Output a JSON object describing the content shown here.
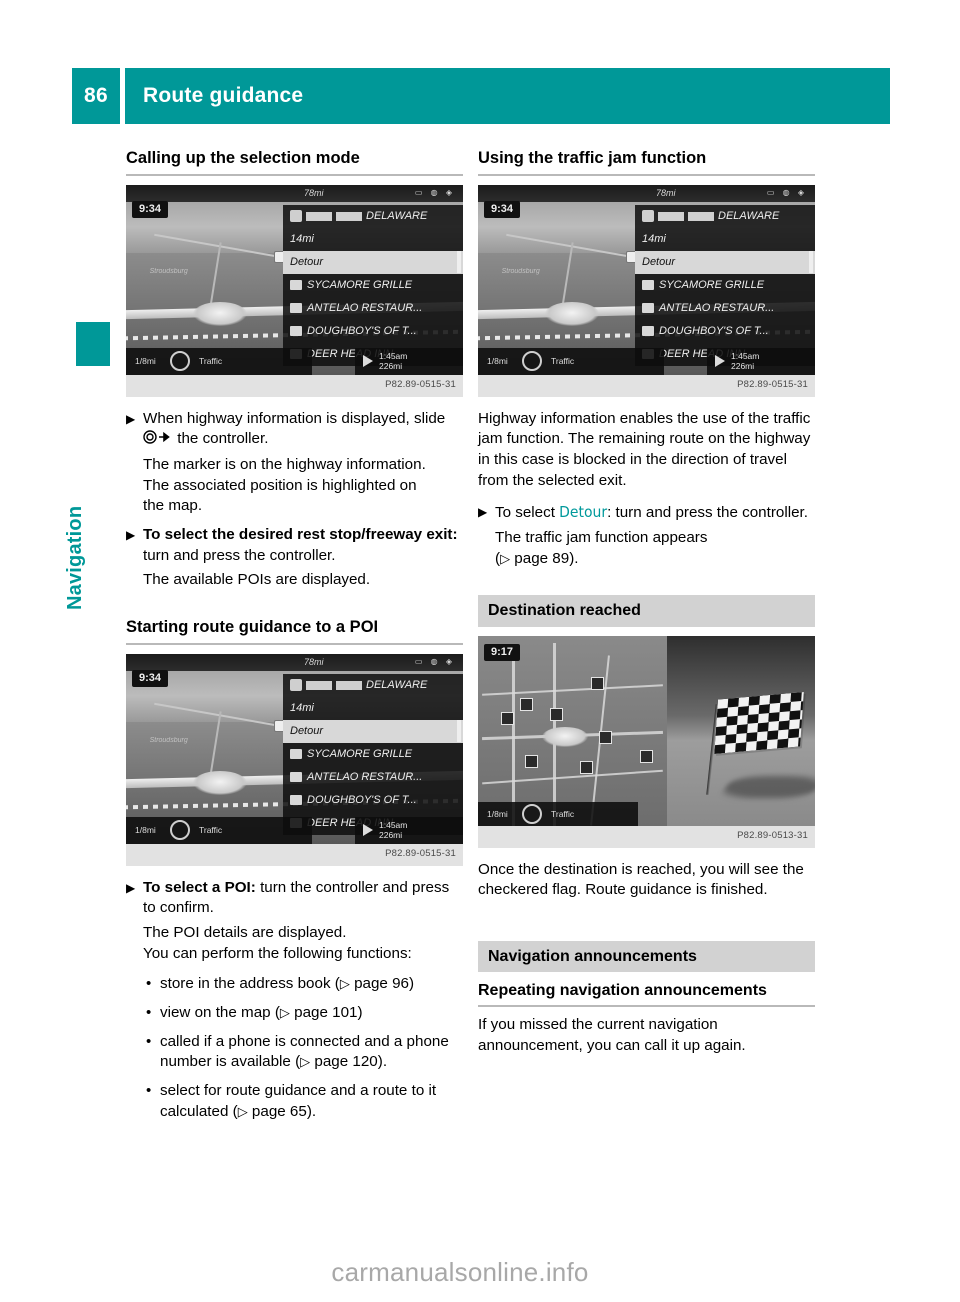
{
  "header": {
    "page_number": "86",
    "title": "Route guidance",
    "accent_color": "#009898"
  },
  "side_tab": {
    "label": "Navigation"
  },
  "left_column": {
    "section1": {
      "heading": "Calling up the selection mode",
      "figure": {
        "caption": "P82.89-0515-31",
        "screen": {
          "clock": "9:34",
          "top_distance": "78mi",
          "road_shield_label": "DELAWARE",
          "distance_to_exit": "14mi",
          "selected_item": "Detour",
          "poi_list": [
            "SYCAMORE GRILLE",
            "ANTELAO RESTAUR...",
            "DOUGHBOY'S OF T...",
            "DEER HEAD INN"
          ],
          "scale": "1/8mi",
          "traffic_label": "Traffic",
          "eta_time": "1:45am",
          "eta_distance": "226mi"
        }
      },
      "steps": [
        {
          "text_before": "When highway information is displayed, slide",
          "glyph": "slide-controller-right-icon",
          "text_after": "the controller.",
          "result_lines": [
            "The marker is on the highway information.",
            "The associated position is highlighted on",
            "the map."
          ]
        },
        {
          "bold_lead": "To select the desired rest stop/freeway exit:",
          "text_after": "turn and press the controller.",
          "result_lines": [
            "The available POIs are displayed."
          ]
        }
      ]
    },
    "section2": {
      "heading": "Starting route guidance to a POI",
      "figure": {
        "caption": "P82.89-0515-31",
        "screen": {
          "clock": "9:34",
          "top_distance": "78mi",
          "road_shield_label": "DELAWARE",
          "distance_to_exit": "14mi",
          "selected_item": "Detour",
          "poi_list": [
            "SYCAMORE GRILLE",
            "ANTELAO RESTAUR...",
            "DOUGHBOY'S OF T...",
            "DEER HEAD INN"
          ],
          "scale": "1/8mi",
          "traffic_label": "Traffic",
          "eta_time": "1:45am",
          "eta_distance": "226mi"
        }
      },
      "step": {
        "bold_lead": "To select a POI:",
        "text_after": "turn the controller and press to confirm.",
        "result_lines": [
          "The POI details are displayed.",
          "You can perform the following functions:"
        ]
      },
      "bullets": [
        {
          "text": "store in the address book",
          "ref": "page 96",
          "tail": ""
        },
        {
          "text": "view on the map",
          "ref": "page 101",
          "tail": ""
        },
        {
          "text": "called if a phone is connected and a phone number is available",
          "ref": "page 120",
          "tail": "."
        },
        {
          "text": "select for route guidance and a route to it calculated",
          "ref": "page 65",
          "tail": "."
        }
      ]
    }
  },
  "right_column": {
    "section1": {
      "heading": "Using the traffic jam function",
      "figure": {
        "caption": "P82.89-0515-31",
        "screen": {
          "clock": "9:34",
          "top_distance": "78mi",
          "road_shield_label": "DELAWARE",
          "distance_to_exit": "14mi",
          "selected_item": "Detour",
          "poi_list": [
            "SYCAMORE GRILLE",
            "ANTELAO RESTAUR...",
            "DOUGHBOY'S OF T...",
            "DEER HEAD INN"
          ],
          "scale": "1/8mi",
          "traffic_label": "Traffic",
          "eta_time": "1:45am",
          "eta_distance": "226mi"
        }
      },
      "paragraph": "Highway information enables the use of the traffic jam function. The remaining route on the highway in this case is blocked in the direction of travel from the selected exit.",
      "step": {
        "text_before": "To select",
        "mb_term": "Detour",
        "text_after": ": turn and press the controller.",
        "result_line": "The traffic jam function appears",
        "ref": "page 89",
        "ref_tail": "."
      }
    },
    "section2": {
      "heading": "Destination reached",
      "figure": {
        "caption": "P82.89-0513-31",
        "screen": {
          "clock": "9:17",
          "scale": "1/8mi",
          "traffic_label": "Traffic",
          "graphic": "checkered-flag"
        }
      },
      "paragraph": "Once the destination is reached, you will see the checkered flag. Route guidance is finished."
    },
    "section3": {
      "heading": "Navigation announcements",
      "subheading": "Repeating navigation announcements",
      "paragraph": "If you missed the current navigation announcement, you can call it up again."
    }
  },
  "watermark": "carmanualsonline.info",
  "glyphs": {
    "step_marker": "▶",
    "bullet_marker": "•",
    "ref_arrow": "▷",
    "arrow_right": "➡"
  }
}
